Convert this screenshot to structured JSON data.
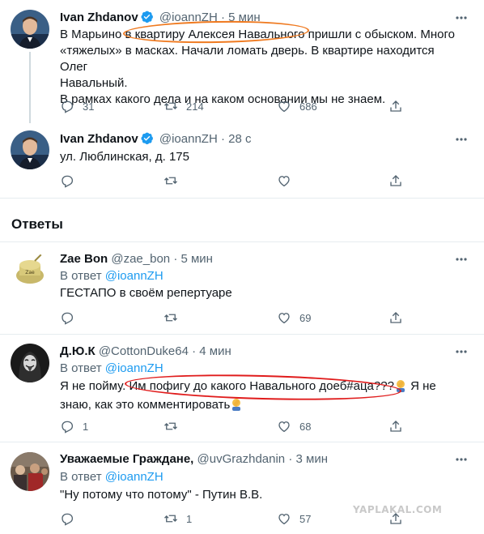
{
  "tweets": [
    {
      "name": "Ivan Zhdanov",
      "handle": "@ioannZH",
      "dot": "·",
      "time": "5 мин",
      "text_line1": "В Марьино в квартиру Алексея Навального пришли с обыском. Много",
      "text_line2": "«тяжелых» в масках. Начали ломать дверь.  В квартире находится Олег",
      "text_line3": "Навальный.",
      "text_line4": "В рамках какого дела и на каком основании мы не знаем.",
      "replies": "31",
      "retweets": "214",
      "likes": "686"
    },
    {
      "name": "Ivan Zhdanov",
      "handle": "@ioannZH",
      "dot": "·",
      "time": "28 с",
      "text": "ул. Люблинская, д. 175",
      "replies": "",
      "retweets": "",
      "likes": ""
    }
  ],
  "section_title": "Ответы",
  "reply_to_prefix": "В ответ",
  "reply_to_handle": "@ioannZH",
  "replies": [
    {
      "name": "Zae Bon",
      "handle": "@zae_bon",
      "dot": "·",
      "time": "5 мин",
      "text": "ГЕСТАПО в своём репертуаре",
      "replies": "",
      "retweets": "",
      "likes": "69"
    },
    {
      "name": "Д.Ю.К",
      "handle": "@CottonDuke64",
      "dot": "·",
      "time": "4 мин",
      "text_line1": "Я не пойму. Им пофигу до какого Навального доеб#аца???",
      "text_line1_b": "Я не",
      "text_line2": "знаю, как это комментировать",
      "replies": "1",
      "retweets": "",
      "likes": "68"
    },
    {
      "name": "Уважаемые Граждане,",
      "handle": "@uvGrazhdanin",
      "dot": "·",
      "time": "3 мин",
      "text": "\"Ну потому что потому\" - Путин В.В.",
      "replies": "",
      "retweets": "1",
      "likes": "57"
    }
  ],
  "watermark": "YAPLAKAL.COM",
  "colors": {
    "text": "#0f1419",
    "muted": "#536471",
    "link": "#1d9bf0",
    "verified": "#1d9bf0",
    "orange_mark": "#ef7a20",
    "red_mark": "#e01c1c"
  }
}
